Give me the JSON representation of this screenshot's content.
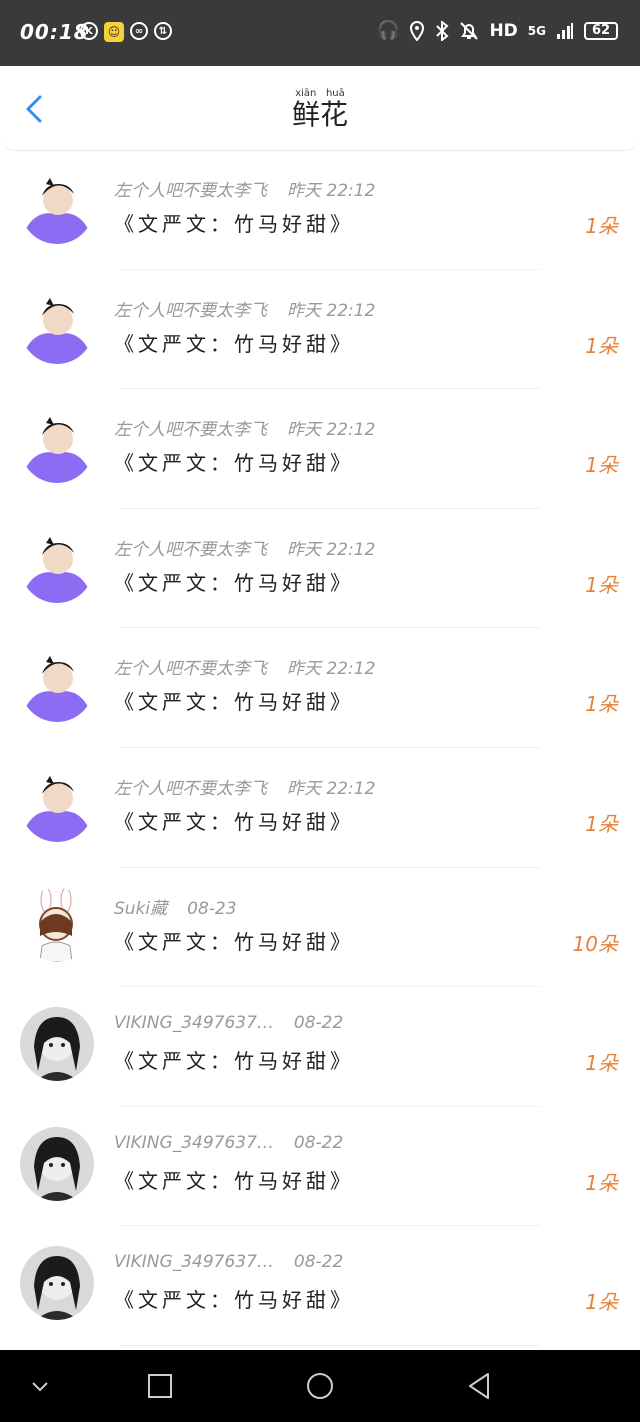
{
  "status": {
    "time": "00:18",
    "network": "HD",
    "signal": "5G",
    "battery": "62"
  },
  "header": {
    "title": "鲜花",
    "title_pinyin": [
      "xiān",
      "huā"
    ]
  },
  "rows": [
    {
      "user": "左个人吧不要太李飞",
      "date": "昨天 22:12",
      "book": "《文严文：竹马好甜》",
      "count": "1朵",
      "avatar": "purple"
    },
    {
      "user": "左个人吧不要太李飞",
      "date": "昨天 22:12",
      "book": "《文严文：竹马好甜》",
      "count": "1朵",
      "avatar": "purple"
    },
    {
      "user": "左个人吧不要太李飞",
      "date": "昨天 22:12",
      "book": "《文严文：竹马好甜》",
      "count": "1朵",
      "avatar": "purple"
    },
    {
      "user": "左个人吧不要太李飞",
      "date": "昨天 22:12",
      "book": "《文严文：竹马好甜》",
      "count": "1朵",
      "avatar": "purple"
    },
    {
      "user": "左个人吧不要太李飞",
      "date": "昨天 22:12",
      "book": "《文严文：竹马好甜》",
      "count": "1朵",
      "avatar": "purple"
    },
    {
      "user": "左个人吧不要太李飞",
      "date": "昨天 22:12",
      "book": "《文严文：竹马好甜》",
      "count": "1朵",
      "avatar": "purple"
    },
    {
      "user": "Suki藏",
      "date": "08-23",
      "book": "《文严文：竹马好甜》",
      "count": "10朵",
      "avatar": "bunny"
    },
    {
      "user": "VIKING_3497637…",
      "date": "08-22",
      "book": "《文严文：竹马好甜》",
      "count": "1朵",
      "avatar": "dark"
    },
    {
      "user": "VIKING_3497637…",
      "date": "08-22",
      "book": "《文严文：竹马好甜》",
      "count": "1朵",
      "avatar": "dark"
    },
    {
      "user": "VIKING_3497637…",
      "date": "08-22",
      "book": "《文严文：竹马好甜》",
      "count": "1朵",
      "avatar": "dark"
    }
  ],
  "colors": {
    "accent": "#2e8df5",
    "count": "#e8813a",
    "meta": "#999999",
    "statusbar": "#3a3a3a"
  }
}
